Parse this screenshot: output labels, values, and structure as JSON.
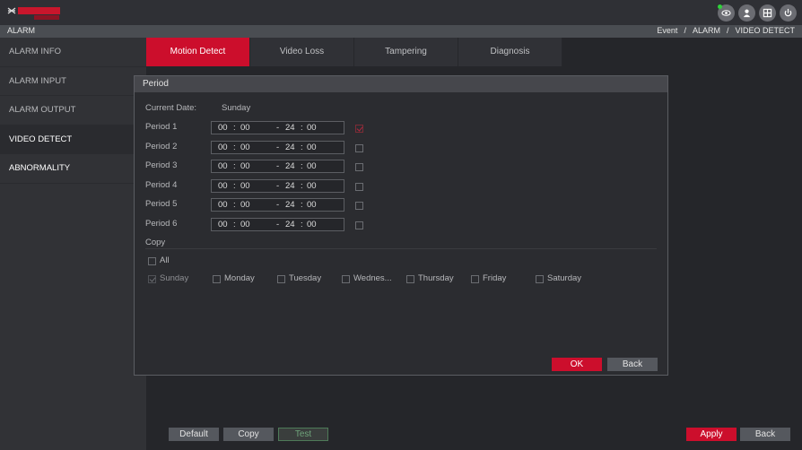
{
  "topbar": {
    "icons": [
      "eye-icon",
      "user-icon",
      "grid-icon",
      "power-icon"
    ],
    "status_color": "#2fd23a"
  },
  "breadcrumb": {
    "title": "ALARM",
    "path": [
      "Event",
      "/",
      "ALARM",
      "/",
      "VIDEO DETECT"
    ]
  },
  "sidebar": {
    "items": [
      {
        "label": "ALARM INFO"
      },
      {
        "label": "ALARM INPUT"
      },
      {
        "label": "ALARM OUTPUT"
      },
      {
        "label": "VIDEO DETECT"
      },
      {
        "label": "ABNORMALITY"
      }
    ]
  },
  "tabs": [
    {
      "label": "Motion Detect"
    },
    {
      "label": "Video Loss"
    },
    {
      "label": "Tampering"
    },
    {
      "label": "Diagnosis"
    }
  ],
  "bottom": {
    "default_label": "Default",
    "copy_label": "Copy",
    "test_label": "Test",
    "apply_label": "Apply",
    "back_label": "Back"
  },
  "dialog": {
    "title": "Period",
    "current_date_label": "Current Date:",
    "current_date_value": "Sunday",
    "periods": [
      {
        "label": "Period 1",
        "start_h": "00",
        "start_m": "00",
        "end_h": "24",
        "end_m": "00",
        "enabled": true
      },
      {
        "label": "Period 2",
        "start_h": "00",
        "start_m": "00",
        "end_h": "24",
        "end_m": "00",
        "enabled": false
      },
      {
        "label": "Period 3",
        "start_h": "00",
        "start_m": "00",
        "end_h": "24",
        "end_m": "00",
        "enabled": false
      },
      {
        "label": "Period 4",
        "start_h": "00",
        "start_m": "00",
        "end_h": "24",
        "end_m": "00",
        "enabled": false
      },
      {
        "label": "Period 5",
        "start_h": "00",
        "start_m": "00",
        "end_h": "24",
        "end_m": "00",
        "enabled": false
      },
      {
        "label": "Period 6",
        "start_h": "00",
        "start_m": "00",
        "end_h": "24",
        "end_m": "00",
        "enabled": false
      }
    ],
    "colon": ":",
    "dash": "-",
    "copy_label": "Copy",
    "all_label": "All",
    "days": [
      "Sunday",
      "Monday",
      "Tuesday",
      "Wednes...",
      "Thursday",
      "Friday",
      "Saturday"
    ],
    "ok_label": "OK",
    "back_label": "Back"
  },
  "colors": {
    "accent": "#cc0e2c",
    "background": "#26272b",
    "panel": "#2b2c30"
  }
}
